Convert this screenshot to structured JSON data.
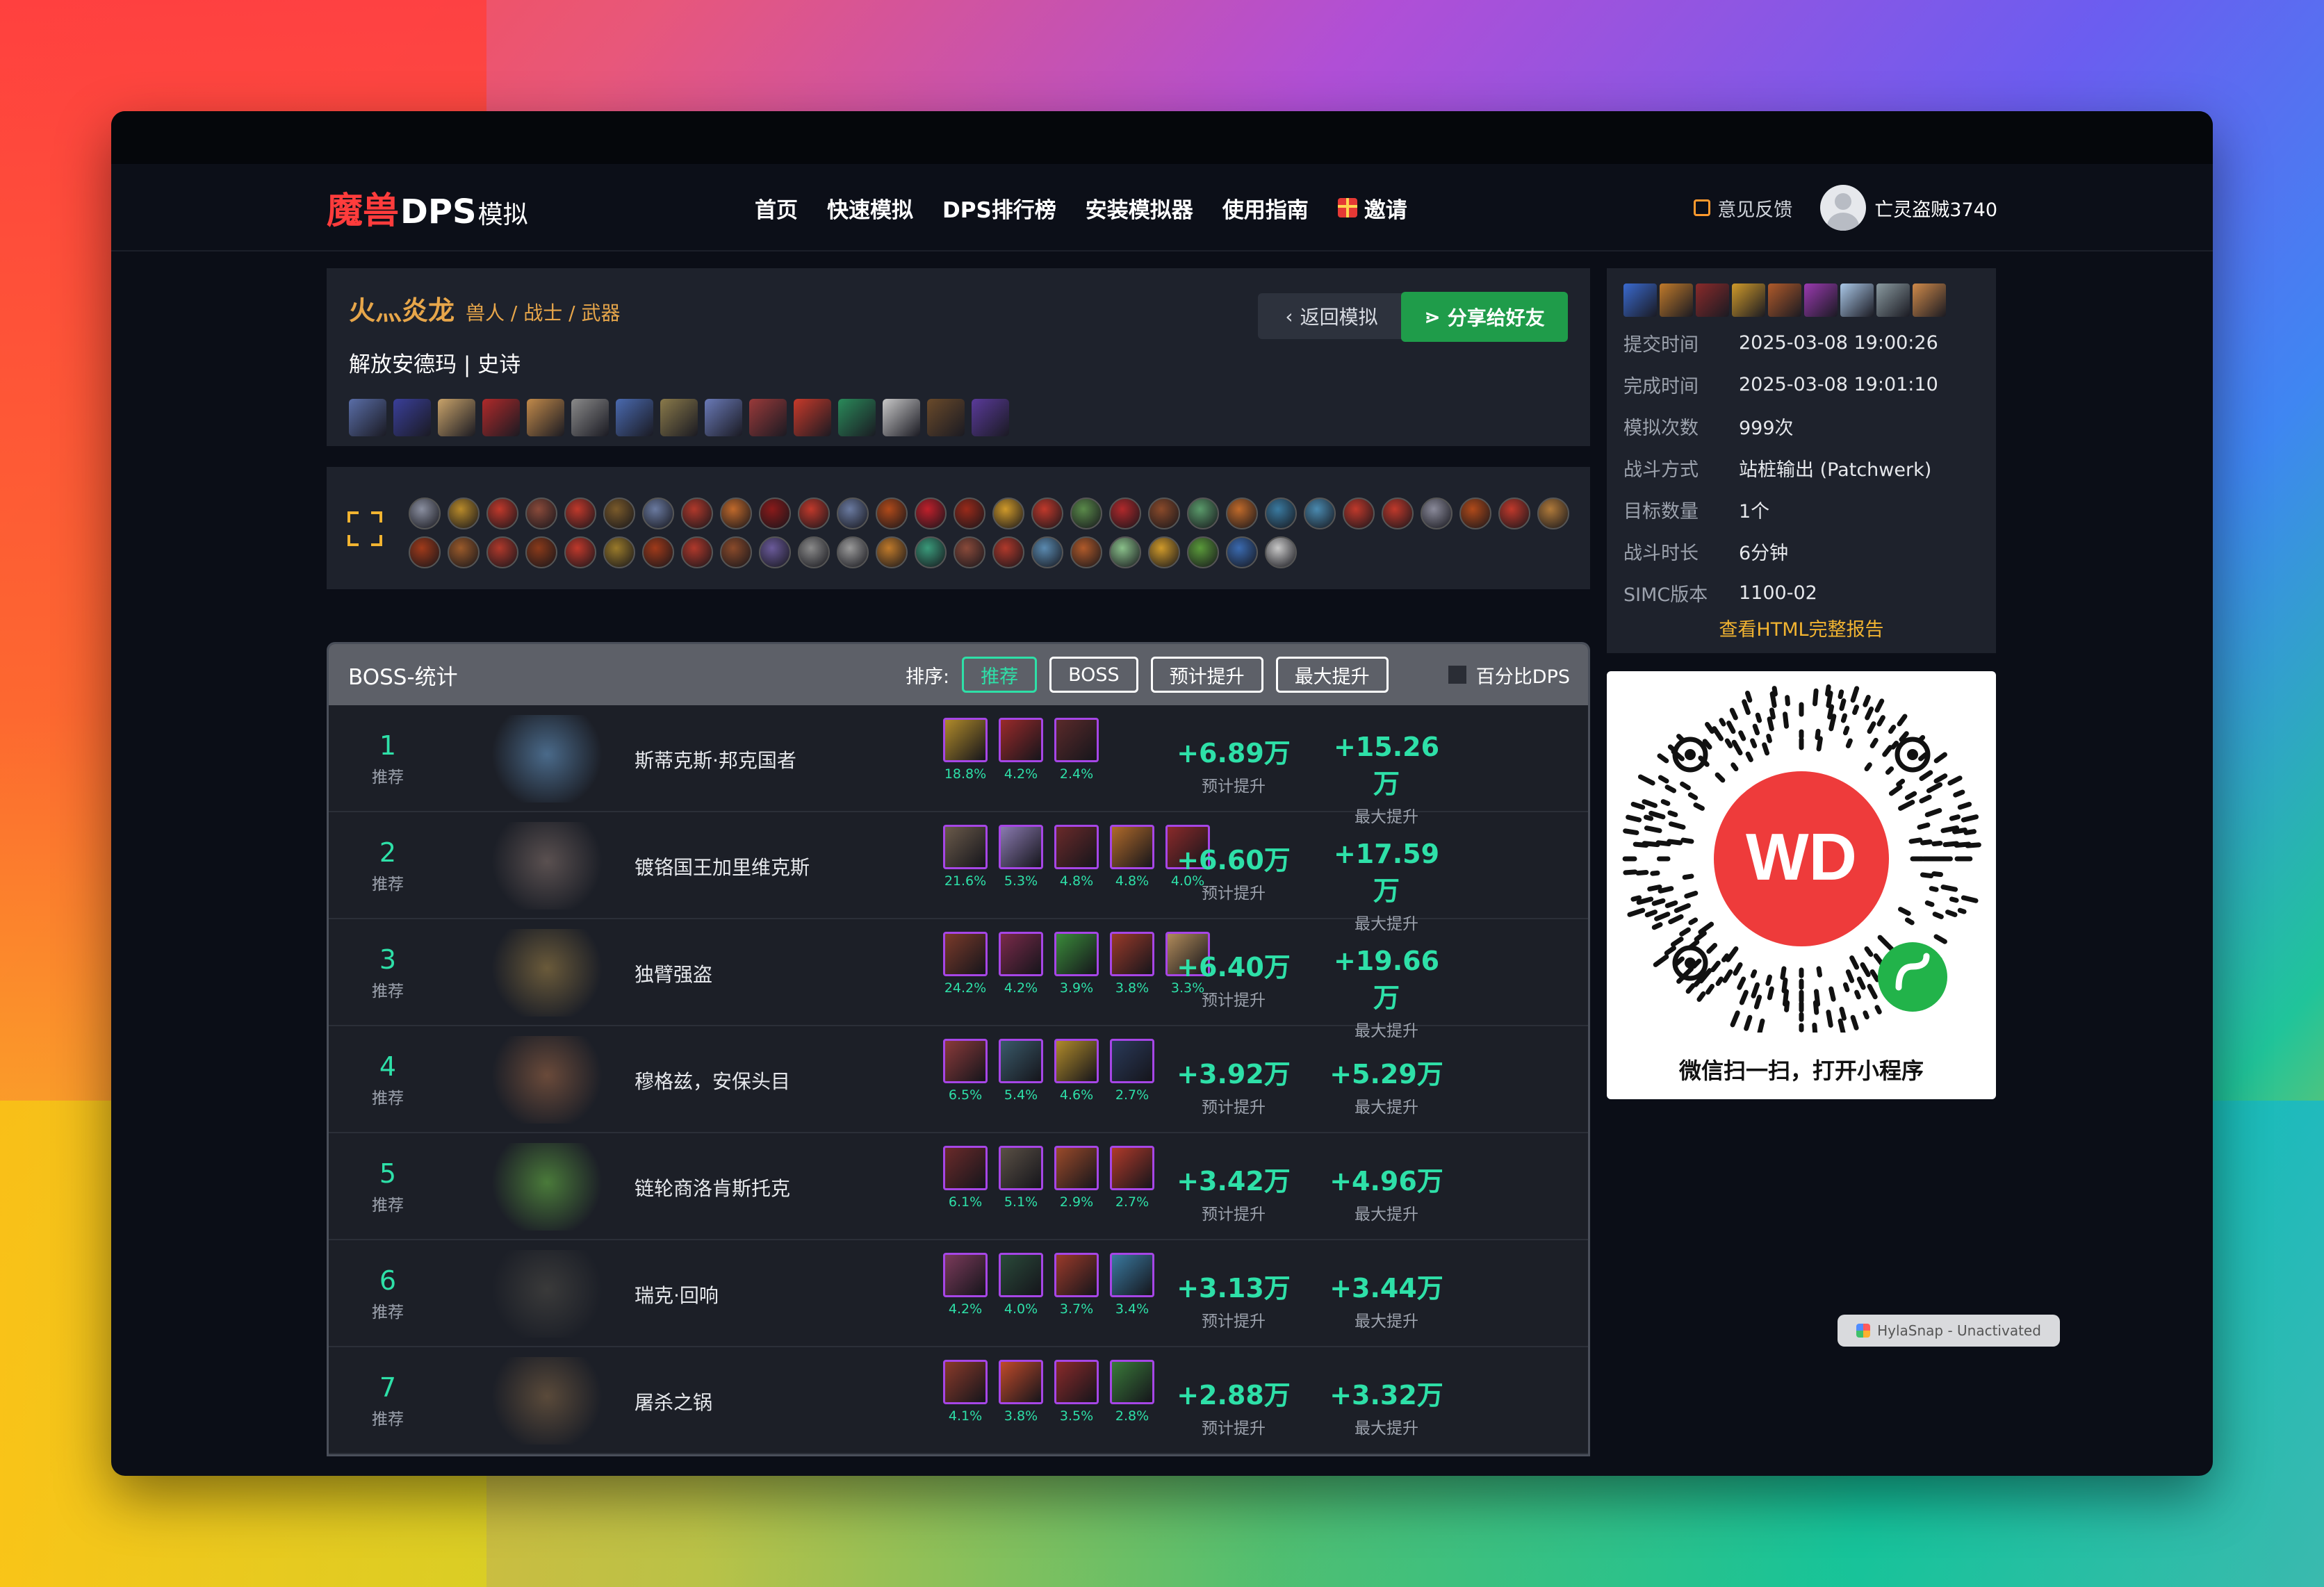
{
  "nav": {
    "logo_red": "魔兽",
    "logo_white": "DPS",
    "logo_small": "模拟",
    "links": [
      "首页",
      "快速模拟",
      "DPS排行榜",
      "安装模拟器",
      "使用指南",
      "邀请"
    ],
    "feedback": "意见反馈",
    "username": "亡灵盗贼3740"
  },
  "character": {
    "name": "火灬炎龙",
    "meta": "兽人 / 战士 / 武器",
    "raid": "解放安德玛 | 史诗",
    "back_label": "返回模拟",
    "share_label": "分享给好友",
    "gear_colors": [
      "#5a6ea8",
      "#3a3f9a",
      "#c9a36a",
      "#b02a2a",
      "#c28a4a",
      "#8a8a8a",
      "#4a6ab0",
      "#8a7a4a",
      "#6a7ab8",
      "#9a3a3a",
      "#c83a2a",
      "#2a8a5a",
      "#c8c8c8",
      "#6a4a2a",
      "#5a3a9a"
    ]
  },
  "talents": {
    "colors": [
      "#8a8fa0",
      "#b88a2a",
      "#c0392b",
      "#8a4a3a",
      "#c0392b",
      "#7a5a2a",
      "#6a7aa0",
      "#b0392b",
      "#c0692b",
      "#8a1a1a",
      "#c0392b",
      "#6a7aa0",
      "#b04a1a",
      "#c0202b",
      "#9a2a1a",
      "#d09a2a",
      "#c0392b",
      "#5a8a4a",
      "#b0292b",
      "#8a4a2a",
      "#5a9a6a",
      "#c06a2a",
      "#3a7aa0",
      "#4a8ab0",
      "#c0392b",
      "#c0392b",
      "#8a8a9a",
      "#b04a1a",
      "#c0392b",
      "#b07a3a",
      "#a03a1a",
      "#9a5a2a",
      "#b0392b",
      "#8a3a1a",
      "#c0392b",
      "#9a7a2a",
      "#a03a1a",
      "#b0392b",
      "#8a4a2a",
      "#6a5a9a",
      "#8a8a8a",
      "#9a9a9a",
      "#c07a2a",
      "#3a9a7a",
      "#8a4a3a",
      "#b0392b",
      "#5a8ab0",
      "#b05a2a",
      "#8ac08a",
      "#d09a2a",
      "#5a9a3a",
      "#3a6ab0",
      "#c8c8c8"
    ]
  },
  "boss_panel": {
    "title": "BOSS-统计",
    "sort_label": "排序:",
    "sort_options": [
      "推荐",
      "BOSS",
      "预计提升",
      "最大提升"
    ],
    "percent_label": "百分比DPS",
    "expected_label": "预计提升",
    "max_label": "最大提升",
    "rows": [
      {
        "rank": "1",
        "rec": "推荐",
        "name": "斯蒂克斯·邦克国者",
        "portrait": "#4a6a8a",
        "expected": "+6.89万",
        "max": "+15.26万",
        "items": [
          {
            "color": "#b08a2a",
            "pct": "18.8%"
          },
          {
            "color": "#9a2a2a",
            "pct": "4.2%"
          },
          {
            "color": "#5a2a2a",
            "pct": "2.4%"
          }
        ]
      },
      {
        "rank": "2",
        "rec": "推荐",
        "name": "镀铬国王加里维克斯",
        "portrait": "#5a5050",
        "expected": "+6.60万",
        "max": "+17.59万",
        "items": [
          {
            "color": "#6a5a4a",
            "pct": "21.6%"
          },
          {
            "color": "#8a7ab0",
            "pct": "5.3%"
          },
          {
            "color": "#6a2a2a",
            "pct": "4.8%"
          },
          {
            "color": "#b06a2a",
            "pct": "4.8%"
          },
          {
            "color": "#8a2a2a",
            "pct": "4.0%"
          }
        ]
      },
      {
        "rank": "3",
        "rec": "推荐",
        "name": "独臂强盗",
        "portrait": "#6a5a3a",
        "expected": "+6.40万",
        "max": "+19.66万",
        "items": [
          {
            "color": "#7a3a2a",
            "pct": "24.2%"
          },
          {
            "color": "#7a2a4a",
            "pct": "4.2%"
          },
          {
            "color": "#3a8a3a",
            "pct": "3.9%"
          },
          {
            "color": "#9a3a2a",
            "pct": "3.8%"
          },
          {
            "color": "#b08a5a",
            "pct": "3.3%"
          }
        ]
      },
      {
        "rank": "4",
        "rec": "推荐",
        "name": "穆格兹，安保头目",
        "portrait": "#6a4a3a",
        "expected": "+3.92万",
        "max": "+5.29万",
        "items": [
          {
            "color": "#8a3a3a",
            "pct": "6.5%"
          },
          {
            "color": "#3a5a6a",
            "pct": "5.4%"
          },
          {
            "color": "#b08a2a",
            "pct": "4.6%"
          },
          {
            "color": "#2a3a5a",
            "pct": "2.7%"
          }
        ]
      },
      {
        "rank": "5",
        "rec": "推荐",
        "name": "链轮商洛肯斯托克",
        "portrait": "#4a7a3a",
        "expected": "+3.42万",
        "max": "+4.96万",
        "items": [
          {
            "color": "#6a2a2a",
            "pct": "6.1%"
          },
          {
            "color": "#5a5045",
            "pct": "5.1%"
          },
          {
            "color": "#9a4a2a",
            "pct": "2.9%"
          },
          {
            "color": "#b03a2a",
            "pct": "2.7%"
          }
        ]
      },
      {
        "rank": "6",
        "rec": "推荐",
        "name": "瑞克·回响",
        "portrait": "#3a3a3a",
        "expected": "+3.13万",
        "max": "+3.44万",
        "items": [
          {
            "color": "#7a3a5a",
            "pct": "4.2%"
          },
          {
            "color": "#2a4a3a",
            "pct": "4.0%"
          },
          {
            "color": "#9a3a2a",
            "pct": "3.7%"
          },
          {
            "color": "#3a7aa0",
            "pct": "3.4%"
          }
        ]
      },
      {
        "rank": "7",
        "rec": "推荐",
        "name": "屠杀之锅",
        "portrait": "#5a4a3a",
        "expected": "+2.88万",
        "max": "+3.32万",
        "items": [
          {
            "color": "#8a3a2a",
            "pct": "4.1%"
          },
          {
            "color": "#c04a2a",
            "pct": "3.8%"
          },
          {
            "color": "#8a2a2a",
            "pct": "3.5%"
          },
          {
            "color": "#3a7a3a",
            "pct": "2.8%"
          }
        ]
      }
    ]
  },
  "sim_info": {
    "buff_colors": [
      "#3a6ad0",
      "#c07a2a",
      "#8a2a2a",
      "#d09a2a",
      "#b05a2a",
      "#9a3ab0",
      "#aac8e8",
      "#8a9aa0",
      "#d08a4a"
    ],
    "rows": [
      {
        "k": "提交时间",
        "v": "2025-03-08 19:00:26"
      },
      {
        "k": "完成时间",
        "v": "2025-03-08 19:01:10"
      },
      {
        "k": "模拟次数",
        "v": "999次"
      },
      {
        "k": "战斗方式",
        "v": "站桩输出 (Patchwerk)"
      },
      {
        "k": "目标数量",
        "v": "1个"
      },
      {
        "k": "战斗时长",
        "v": "6分钟"
      },
      {
        "k": "SIMC版本",
        "v": "1100-02"
      }
    ],
    "report_link": "查看HTML完整报告"
  },
  "qr": {
    "logo_text": "WD",
    "caption": "微信扫一扫，打开小程序",
    "accent": "#ee3b3b",
    "badge_color": "#22b34a"
  },
  "snap_badge": "HylaSnap - Unactivated"
}
